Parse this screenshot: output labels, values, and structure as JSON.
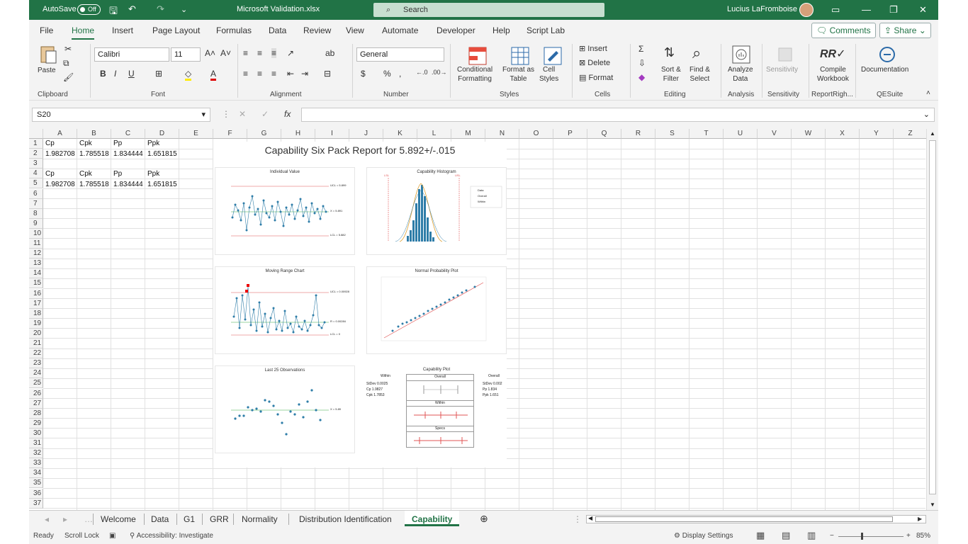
{
  "titlebar": {
    "autosave_label": "AutoSave",
    "autosave_state": "Off",
    "filename": "Microsoft Validation.xlsx",
    "search_placeholder": "Search",
    "user_name": "Lucius LaFromboise"
  },
  "menu": {
    "tabs": [
      "File",
      "Home",
      "Insert",
      "Page Layout",
      "Formulas",
      "Data",
      "Review",
      "View",
      "Automate",
      "Developer",
      "Help",
      "Script Lab"
    ],
    "active": "Home",
    "comments_label": "Comments",
    "share_label": "Share"
  },
  "ribbon": {
    "paste": "Paste",
    "font_name": "Calibri",
    "font_size": "11",
    "number_format": "General",
    "conditional_formatting": [
      "Conditional",
      "Formatting"
    ],
    "format_as_table": [
      "Format as",
      "Table"
    ],
    "cell_styles": [
      "Cell",
      "Styles"
    ],
    "insert": "Insert",
    "delete": "Delete",
    "format": "Format",
    "sort_filter": [
      "Sort &",
      "Filter"
    ],
    "find_select": [
      "Find &",
      "Select"
    ],
    "analyze_data": [
      "Analyze",
      "Data"
    ],
    "sensitivity": "Sensitivity",
    "compile_workbook": [
      "Compile",
      "Workbook"
    ],
    "documentation": "Documentation",
    "groups": [
      "Clipboard",
      "Font",
      "Alignment",
      "Number",
      "Styles",
      "Cells",
      "Editing",
      "Analysis",
      "Sensitivity",
      "ReportRigh...",
      "QESuite"
    ]
  },
  "formula": {
    "name_box": "S20",
    "value": ""
  },
  "grid": {
    "columns": [
      "A",
      "B",
      "C",
      "D",
      "E",
      "F",
      "G",
      "H",
      "I",
      "J",
      "K",
      "L",
      "M",
      "N",
      "O",
      "P",
      "Q",
      "R",
      "S",
      "T",
      "U",
      "V",
      "W",
      "X",
      "Y",
      "Z"
    ],
    "rows": [
      "1",
      "2",
      "3",
      "4",
      "5",
      "6",
      "7",
      "8",
      "9",
      "10",
      "11",
      "12",
      "13",
      "14",
      "15",
      "16",
      "17",
      "18",
      "19",
      "20",
      "21",
      "22",
      "23",
      "24",
      "25",
      "26",
      "27",
      "28",
      "29",
      "30",
      "31",
      "32",
      "33",
      "34",
      "35",
      "36",
      "37"
    ],
    "table1_header": [
      "Cp",
      "Cpk",
      "Pp",
      "Ppk"
    ],
    "table1_values": [
      "1.982708",
      "1.785518",
      "1.834444",
      "1.651815"
    ],
    "table2_header": [
      "Cp",
      "Cpk",
      "Pp",
      "Ppk"
    ],
    "table2_values": [
      "1.982708",
      "1.785518",
      "1.834444",
      "1.651815"
    ]
  },
  "report": {
    "title": "Capability Six Pack Report for 5.892+/-.015",
    "individual_value": {
      "title": "Individual Value",
      "ucl": "UCL = 5.899",
      "mean": "X = 5.891",
      "lcl": "LCL = 5.882"
    },
    "histogram": {
      "title": "Capability Histogram",
      "lsl": "LSL",
      "usl": "USL",
      "legend": [
        "Data",
        "Overall",
        "Within"
      ]
    },
    "moving_range": {
      "title": "Moving Range Chart",
      "ucl": "UCL = 0.00928",
      "mean": "R = 0.00284",
      "lcl": "LCL = 0"
    },
    "normal_probability": {
      "title": "Normal Probability Plot"
    },
    "last25": {
      "title": "Last 25 Observations",
      "mean": "X = 5.89"
    },
    "capability_plot": {
      "title": "Capability Plot",
      "within_label": "Within",
      "overall_label": "Overall",
      "specs_label": "Specs",
      "within_stats": [
        [
          "StDev",
          "0.0025"
        ],
        [
          "Cp",
          "1.9827"
        ],
        [
          "Cpk",
          "1.7853"
        ]
      ],
      "overall_stats": [
        [
          "StDev",
          "0.002"
        ],
        [
          "Pp",
          "1.834"
        ],
        [
          "Ppk",
          "1.651"
        ]
      ]
    }
  },
  "sheets": {
    "tabs": [
      "Welcome",
      "Data",
      "G1",
      "GRR",
      "Normality",
      "Distribution Identification",
      "Capability"
    ],
    "active": "Capability"
  },
  "status": {
    "ready": "Ready",
    "scroll_lock": "Scroll Lock",
    "accessibility": "Accessibility: Investigate",
    "display_settings": "Display Settings",
    "zoom": "85%"
  }
}
